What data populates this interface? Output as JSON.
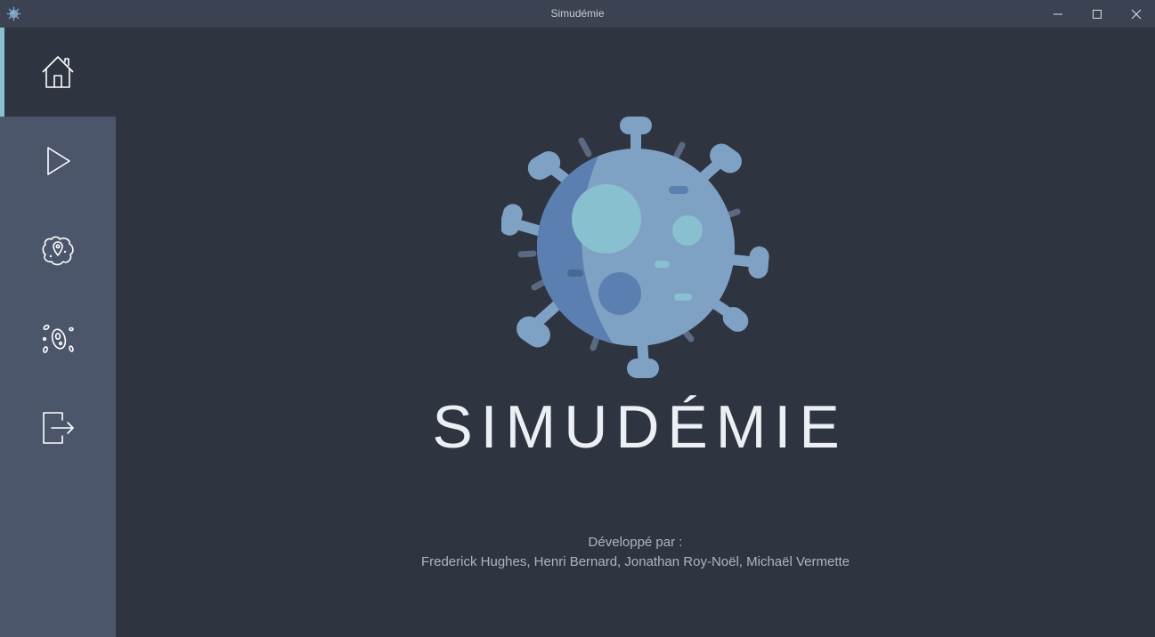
{
  "window": {
    "title": "Simudémie",
    "icon": "virus-icon",
    "controls": [
      "minimize-icon",
      "maximize-icon",
      "close-icon"
    ]
  },
  "sidebar": {
    "items": [
      {
        "name": "home",
        "icon": "home-icon",
        "active": true
      },
      {
        "name": "play",
        "icon": "play-icon",
        "active": false
      },
      {
        "name": "map",
        "icon": "map-pin-icon",
        "active": false
      },
      {
        "name": "pathogen",
        "icon": "bacteria-icon",
        "active": false
      },
      {
        "name": "exit",
        "icon": "exit-icon",
        "active": false
      }
    ],
    "accent_color": "#88c0d0"
  },
  "main": {
    "logo_icon": "virus-logo",
    "title": "SIMUDÉMIE",
    "credits_label": "Développé par :",
    "credits_names": "Frederick Hughes, Henri Bernard, Jonathan Roy-Noël, Michaël Vermette"
  },
  "colors": {
    "background": "#2e3440",
    "sidebar": "#4c566a",
    "titlebar": "#3b4252",
    "virus_body": "#7fa1c4",
    "virus_dark": "#5b7fb0"
  }
}
